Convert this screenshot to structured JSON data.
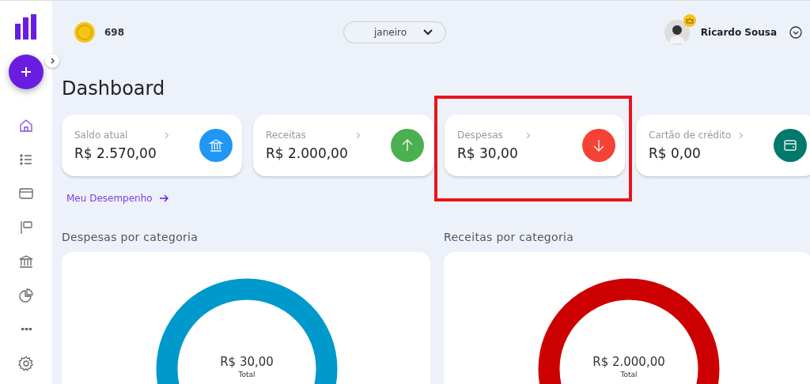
{
  "topbar": {
    "coins": "698",
    "month": "janeiro",
    "user": "Ricardo Sousa"
  },
  "sidebar": {
    "items": [
      {
        "kind": "home",
        "selected": true
      },
      {
        "kind": "list",
        "selected": false
      },
      {
        "kind": "wallet",
        "selected": false
      },
      {
        "kind": "flag",
        "selected": false
      },
      {
        "kind": "bank",
        "selected": false
      },
      {
        "kind": "pie",
        "selected": false
      },
      {
        "kind": "more",
        "selected": false
      },
      {
        "kind": "settings",
        "selected": false
      }
    ]
  },
  "title": "Dashboard",
  "cards": [
    {
      "label": "Saldo atual",
      "value": "R$ 2.570,00",
      "kind": "bank",
      "color": "#2196f3",
      "highlighted": false
    },
    {
      "label": "Receitas",
      "value": "R$ 2.000,00",
      "kind": "up",
      "color": "#4caf50",
      "highlighted": false
    },
    {
      "label": "Despesas",
      "value": "R$ 30,00",
      "kind": "down",
      "color": "#f44336",
      "highlighted": true
    },
    {
      "label": "Cartão de crédito",
      "value": "R$ 0,00",
      "kind": "card",
      "color": "#00796b",
      "highlighted": false
    }
  ],
  "performance_link": "Meu Desempenho",
  "panels": [
    {
      "title": "Despesas por categoria",
      "total": "R$ 30,00",
      "total_label": "Total",
      "color": "#0099cc"
    },
    {
      "title": "Receitas por categoria",
      "total": "R$ 2.000,00",
      "total_label": "Total",
      "color": "#cc0000"
    }
  ]
}
